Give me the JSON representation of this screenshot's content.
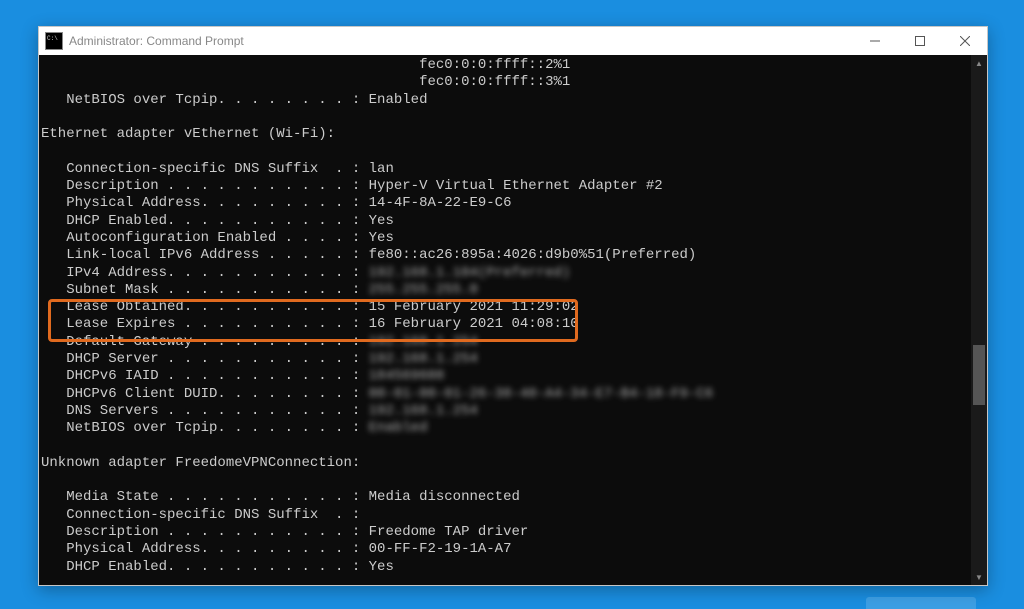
{
  "window": {
    "title": "Administrator: Command Prompt"
  },
  "lines": [
    {
      "indent": 44,
      "label": "",
      "dots": "",
      "value": "fec0:0:0:ffff::2%1"
    },
    {
      "indent": 44,
      "label": "",
      "dots": "",
      "value": "fec0:0:0:ffff::3%1"
    },
    {
      "indent": 3,
      "label": "NetBIOS over Tcpip",
      "dots": ". . . . . . . . :",
      "value": "Enabled"
    },
    {
      "blank": true
    },
    {
      "indent": 0,
      "label": "Ethernet adapter vEthernet (Wi-Fi):",
      "dots": "",
      "value": ""
    },
    {
      "blank": true
    },
    {
      "indent": 3,
      "label": "Connection-specific DNS Suffix",
      "dots": "  . :",
      "value": "lan"
    },
    {
      "indent": 3,
      "label": "Description",
      "dots": " . . . . . . . . . . . :",
      "value": "Hyper-V Virtual Ethernet Adapter #2"
    },
    {
      "indent": 3,
      "label": "Physical Address",
      "dots": ". . . . . . . . . :",
      "value": "14-4F-8A-22-E9-C6"
    },
    {
      "indent": 3,
      "label": "DHCP Enabled",
      "dots": ". . . . . . . . . . . :",
      "value": "Yes"
    },
    {
      "indent": 3,
      "label": "Autoconfiguration Enabled",
      "dots": " . . . . :",
      "value": "Yes"
    },
    {
      "indent": 3,
      "label": "Link-local IPv6 Address",
      "dots": " . . . . . :",
      "value": "fe80::ac26:895a:4026:d9b0%51(Preferred)"
    },
    {
      "indent": 3,
      "label": "IPv4 Address",
      "dots": ". . . . . . . . . . . :",
      "value": "192.168.1.104(Preferred)",
      "blur": true
    },
    {
      "indent": 3,
      "label": "Subnet Mask",
      "dots": " . . . . . . . . . . . :",
      "value": "255.255.255.0",
      "blur": true
    },
    {
      "indent": 3,
      "label": "Lease Obtained",
      "dots": ". . . . . . . . . . :",
      "value": "15 February 2021 11:29:02"
    },
    {
      "indent": 3,
      "label": "Lease Expires",
      "dots": " . . . . . . . . . . :",
      "value": "16 February 2021 04:08:10"
    },
    {
      "indent": 3,
      "label": "Default Gateway",
      "dots": " . . . . . . . . . :",
      "value": "192.168.1.254",
      "blur": true
    },
    {
      "indent": 3,
      "label": "DHCP Server",
      "dots": " . . . . . . . . . . . :",
      "value": "192.168.1.254",
      "blur": true
    },
    {
      "indent": 3,
      "label": "DHCPv6 IAID",
      "dots": " . . . . . . . . . . . :",
      "value": "184569608",
      "blur": true
    },
    {
      "indent": 3,
      "label": "DHCPv6 Client DUID",
      "dots": ". . . . . . . . :",
      "value": "00-01-00-01-26-38-40-A4-34-E7-B4-18-F9-C6",
      "blur": true
    },
    {
      "indent": 3,
      "label": "DNS Servers",
      "dots": " . . . . . . . . . . . :",
      "value": "192.168.1.254",
      "blur": true
    },
    {
      "indent": 3,
      "label": "NetBIOS over Tcpip",
      "dots": ". . . . . . . . :",
      "value": "Enabled",
      "blur": true
    },
    {
      "blank": true
    },
    {
      "indent": 0,
      "label": "Unknown adapter FreedomeVPNConnection:",
      "dots": "",
      "value": ""
    },
    {
      "blank": true
    },
    {
      "indent": 3,
      "label": "Media State",
      "dots": " . . . . . . . . . . . :",
      "value": "Media disconnected"
    },
    {
      "indent": 3,
      "label": "Connection-specific DNS Suffix",
      "dots": "  . :",
      "value": ""
    },
    {
      "indent": 3,
      "label": "Description",
      "dots": " . . . . . . . . . . . :",
      "value": "Freedome TAP driver"
    },
    {
      "indent": 3,
      "label": "Physical Address",
      "dots": ". . . . . . . . . :",
      "value": "00-FF-F2-19-1A-A7"
    },
    {
      "indent": 3,
      "label": "DHCP Enabled",
      "dots": ". . . . . . . . . . . :",
      "value": "Yes"
    }
  ]
}
